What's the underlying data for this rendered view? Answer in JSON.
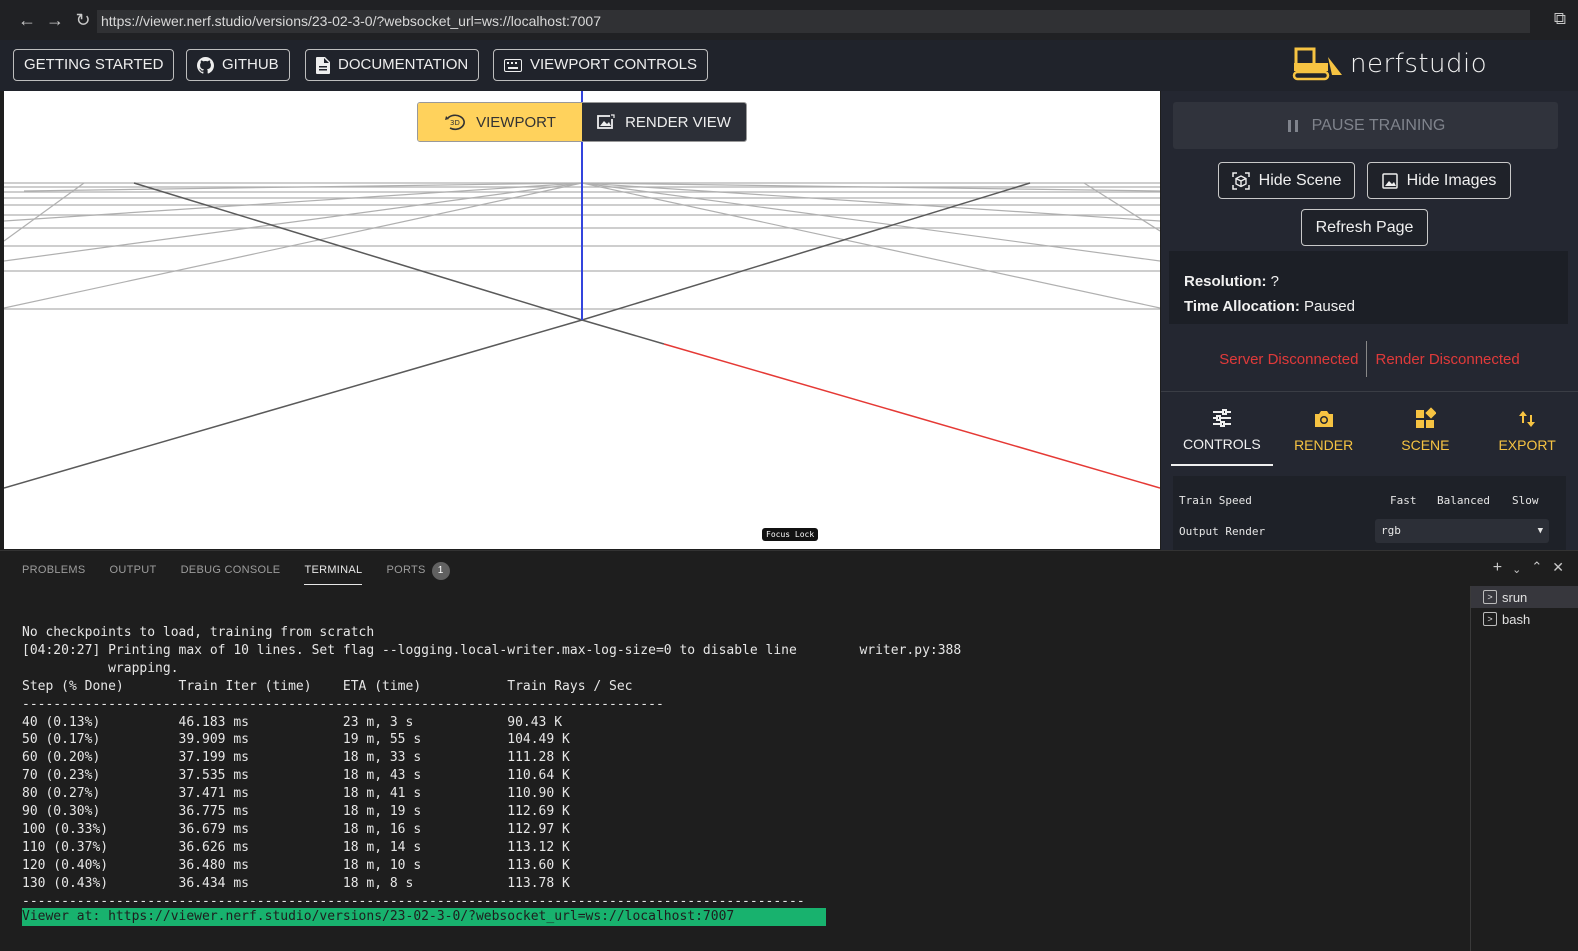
{
  "browser": {
    "url": "https://viewer.nerf.studio/versions/23-02-3-0/?websocket_url=ws://localhost:7007"
  },
  "header": {
    "buttons": [
      "GETTING STARTED",
      "GITHUB",
      "DOCUMENTATION",
      "VIEWPORT CONTROLS"
    ],
    "logo_text": "nerfstudio"
  },
  "viewport": {
    "mode_viewport": "VIEWPORT",
    "mode_render": "RENDER VIEW",
    "focus_lock": "Focus Lock"
  },
  "panel": {
    "pause": "PAUSE TRAINING",
    "hide_scene": "Hide Scene",
    "hide_images": "Hide Images",
    "refresh": "Refresh Page",
    "resolution_label": "Resolution:",
    "resolution_value": "?",
    "time_label": "Time Allocation:",
    "time_value": "Paused",
    "server_status": "Server Disconnected",
    "render_status": "Render Disconnected",
    "tabs": [
      "CONTROLS",
      "RENDER",
      "SCENE",
      "EXPORT"
    ],
    "train_speed_label": "Train Speed",
    "speed_options": [
      "Fast",
      "Balanced",
      "Slow"
    ],
    "output_render_label": "Output Render",
    "output_render_value": "rgb"
  },
  "bottom": {
    "tabs": [
      "PROBLEMS",
      "OUTPUT",
      "DEBUG CONSOLE",
      "TERMINAL",
      "PORTS"
    ],
    "ports_count": "1",
    "terminals": [
      "srun",
      "bash"
    ]
  },
  "terminal": {
    "text": "No checkpoints to load, training from scratch\n[04:20:27] Printing max of 10 lines. Set flag --logging.local-writer.max-log-size=0 to disable line        writer.py:388\n           wrapping.\nStep (% Done)       Train Iter (time)    ETA (time)           Train Rays / Sec\n----------------------------------------------------------------------------------\n40 (0.13%)          46.183 ms            23 m, 3 s            90.43 K\n50 (0.17%)          39.909 ms            19 m, 55 s           104.49 K\n60 (0.20%)          37.199 ms            18 m, 33 s           111.28 K\n70 (0.23%)          37.535 ms            18 m, 43 s           110.64 K\n80 (0.27%)          37.471 ms            18 m, 41 s           110.90 K\n90 (0.30%)          36.775 ms            18 m, 19 s           112.69 K\n100 (0.33%)         36.679 ms            18 m, 16 s           112.97 K\n110 (0.37%)         36.626 ms            18 m, 14 s           113.12 K\n120 (0.40%)         36.480 ms            18 m, 10 s           113.60 K\n130 (0.43%)         36.434 ms            18 m, 8 s            113.78 K\n----------------------------------------------------------------------------------------------------",
    "viewer_line": "Viewer at: https://viewer.nerf.studio/versions/23-02-3-0/?websocket_url=ws://localhost:7007"
  },
  "colors": {
    "accent": "#ffd25c",
    "error": "#e03a3a",
    "highlight": "#18b26e"
  }
}
